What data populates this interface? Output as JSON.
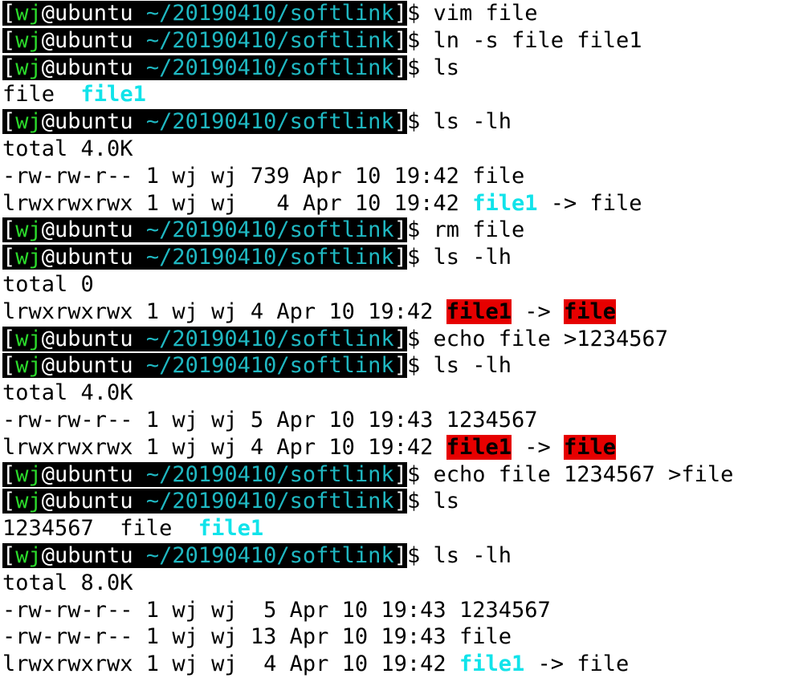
{
  "prompt": {
    "open_bracket": "[",
    "user": "wj",
    "host": "@ubuntu",
    "path": " ~/20190410/softlink",
    "close_bracket": "]",
    "dollar": "$ "
  },
  "colors": {
    "prompt_background": "#000000",
    "user": "#2bd92b",
    "path": "#1fb8c2",
    "symlink": "#11e3ea",
    "broken_symlink_background": "#e60000"
  },
  "lines": [
    {
      "type": "prompt",
      "cmd": "vim file"
    },
    {
      "type": "prompt",
      "cmd": "ln -s file file1"
    },
    {
      "type": "prompt",
      "cmd": "ls"
    },
    {
      "type": "output",
      "parts": [
        {
          "t": "file  "
        },
        {
          "t": "file1",
          "c": "cyan"
        }
      ]
    },
    {
      "type": "prompt",
      "cmd": "ls -lh"
    },
    {
      "type": "output",
      "parts": [
        {
          "t": "total 4.0K"
        }
      ]
    },
    {
      "type": "output",
      "parts": [
        {
          "t": "-rw-rw-r-- 1 wj wj 739 Apr 10 19:42 file"
        }
      ]
    },
    {
      "type": "output",
      "parts": [
        {
          "t": "lrwxrwxrwx 1 wj wj   4 Apr 10 19:42 "
        },
        {
          "t": "file1",
          "c": "cyan"
        },
        {
          "t": " -> file"
        }
      ]
    },
    {
      "type": "prompt",
      "cmd": "rm file"
    },
    {
      "type": "prompt",
      "cmd": "ls -lh"
    },
    {
      "type": "output",
      "parts": [
        {
          "t": "total 0"
        }
      ]
    },
    {
      "type": "output",
      "parts": [
        {
          "t": "lrwxrwxrwx 1 wj wj 4 Apr 10 19:42 "
        },
        {
          "t": "file1",
          "c": "broken"
        },
        {
          "t": " -> "
        },
        {
          "t": "file",
          "c": "broken"
        }
      ]
    },
    {
      "type": "prompt",
      "cmd": "echo file >1234567"
    },
    {
      "type": "prompt",
      "cmd": "ls -lh"
    },
    {
      "type": "output",
      "parts": [
        {
          "t": "total 4.0K"
        }
      ]
    },
    {
      "type": "output",
      "parts": [
        {
          "t": "-rw-rw-r-- 1 wj wj 5 Apr 10 19:43 1234567"
        }
      ]
    },
    {
      "type": "output",
      "parts": [
        {
          "t": "lrwxrwxrwx 1 wj wj 4 Apr 10 19:42 "
        },
        {
          "t": "file1",
          "c": "broken"
        },
        {
          "t": " -> "
        },
        {
          "t": "file",
          "c": "broken"
        }
      ]
    },
    {
      "type": "prompt",
      "cmd": "echo file 1234567 >file"
    },
    {
      "type": "prompt",
      "cmd": "ls"
    },
    {
      "type": "output",
      "parts": [
        {
          "t": "1234567  file  "
        },
        {
          "t": "file1",
          "c": "cyan"
        }
      ]
    },
    {
      "type": "prompt",
      "cmd": "ls -lh"
    },
    {
      "type": "output",
      "parts": [
        {
          "t": "total 8.0K"
        }
      ]
    },
    {
      "type": "output",
      "parts": [
        {
          "t": "-rw-rw-r-- 1 wj wj  5 Apr 10 19:43 1234567"
        }
      ]
    },
    {
      "type": "output",
      "parts": [
        {
          "t": "-rw-rw-r-- 1 wj wj 13 Apr 10 19:43 file"
        }
      ]
    },
    {
      "type": "output",
      "parts": [
        {
          "t": "lrwxrwxrwx 1 wj wj  4 Apr 10 19:42 "
        },
        {
          "t": "file1",
          "c": "cyan"
        },
        {
          "t": " -> file"
        }
      ]
    }
  ]
}
